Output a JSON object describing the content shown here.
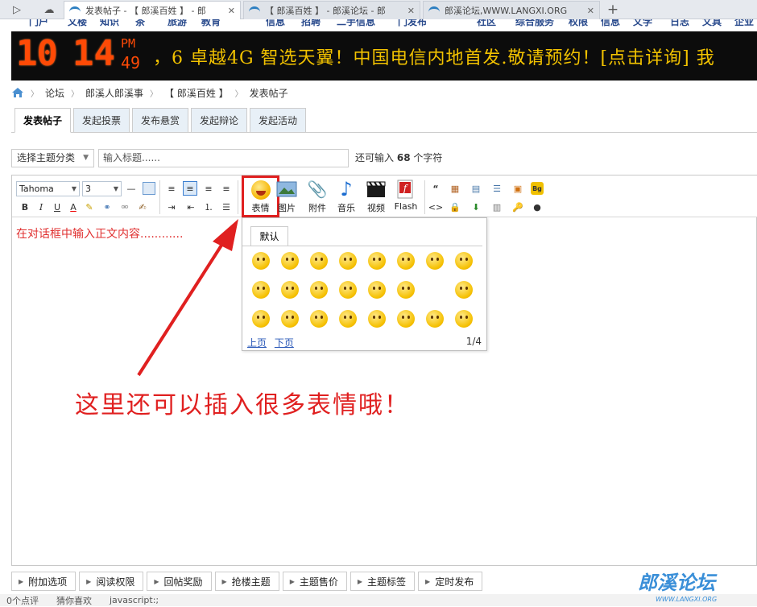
{
  "browser": {
    "tabs": [
      {
        "title": "发表帖子 - 【 郎溪百姓 】 - 郎",
        "active": true
      },
      {
        "title": "【 郎溪百姓 】 - 郎溪论坛 - 郎",
        "active": false
      },
      {
        "title": "郎溪论坛,WWW.LANGXI.ORG",
        "active": false
      }
    ],
    "new_tab": "+"
  },
  "nav_cut": [
    "门户",
    "文楼",
    "知识",
    "茶",
    "旅游",
    "教育",
    "信息",
    "招聘",
    "二手信息",
    "门发布",
    "社区",
    "综合服务",
    "权限",
    "信息",
    "文学",
    "日志",
    "文具",
    "企业"
  ],
  "banner": {
    "clock_hours": "10",
    "clock_minutes": "14",
    "clock_ampm": "PM",
    "clock_seconds": "49",
    "marquee": "，6 卓越4G 智选天翼！中国电信内地首发.敬请预约！[点击详询] 我"
  },
  "breadcrumb": [
    "论坛",
    "郎溪人郎溪事",
    "【 郎溪百姓 】",
    "发表帖子"
  ],
  "post_tabs": [
    "发表帖子",
    "发起投票",
    "发布悬赏",
    "发起辩论",
    "发起活动"
  ],
  "title_row": {
    "category_select": "选择主题分类",
    "title_placeholder": "输入标题......",
    "remaining_prefix": "还可输入",
    "remaining_count": "68",
    "remaining_suffix": "个字符"
  },
  "toolbar": {
    "font": "Tahoma",
    "size": "3",
    "buttons": [
      "表情",
      "图片",
      "附件",
      "音乐",
      "视频",
      "Flash"
    ]
  },
  "editor_body": "在对话框中输入正文内容............",
  "emoji_panel": {
    "tab": "默认",
    "prev": "上页",
    "next": "下页",
    "page": "1/4"
  },
  "annotation": "这里还可以插入很多表情哦！",
  "options": [
    "附加选项",
    "阅读权限",
    "回帖奖励",
    "抢楼主题",
    "主题售价",
    "主题标签",
    "定时发布"
  ],
  "status_bar": [
    "0个点评",
    "猜你喜欢",
    "javascript:;"
  ],
  "logo": {
    "text": "郎溪论坛",
    "url": "WWW.LANGXI.ORG"
  },
  "colors": {
    "accent": "#e02020",
    "link": "#2a58b8",
    "led": "#ff4a06",
    "marquee": "#f2c200"
  }
}
